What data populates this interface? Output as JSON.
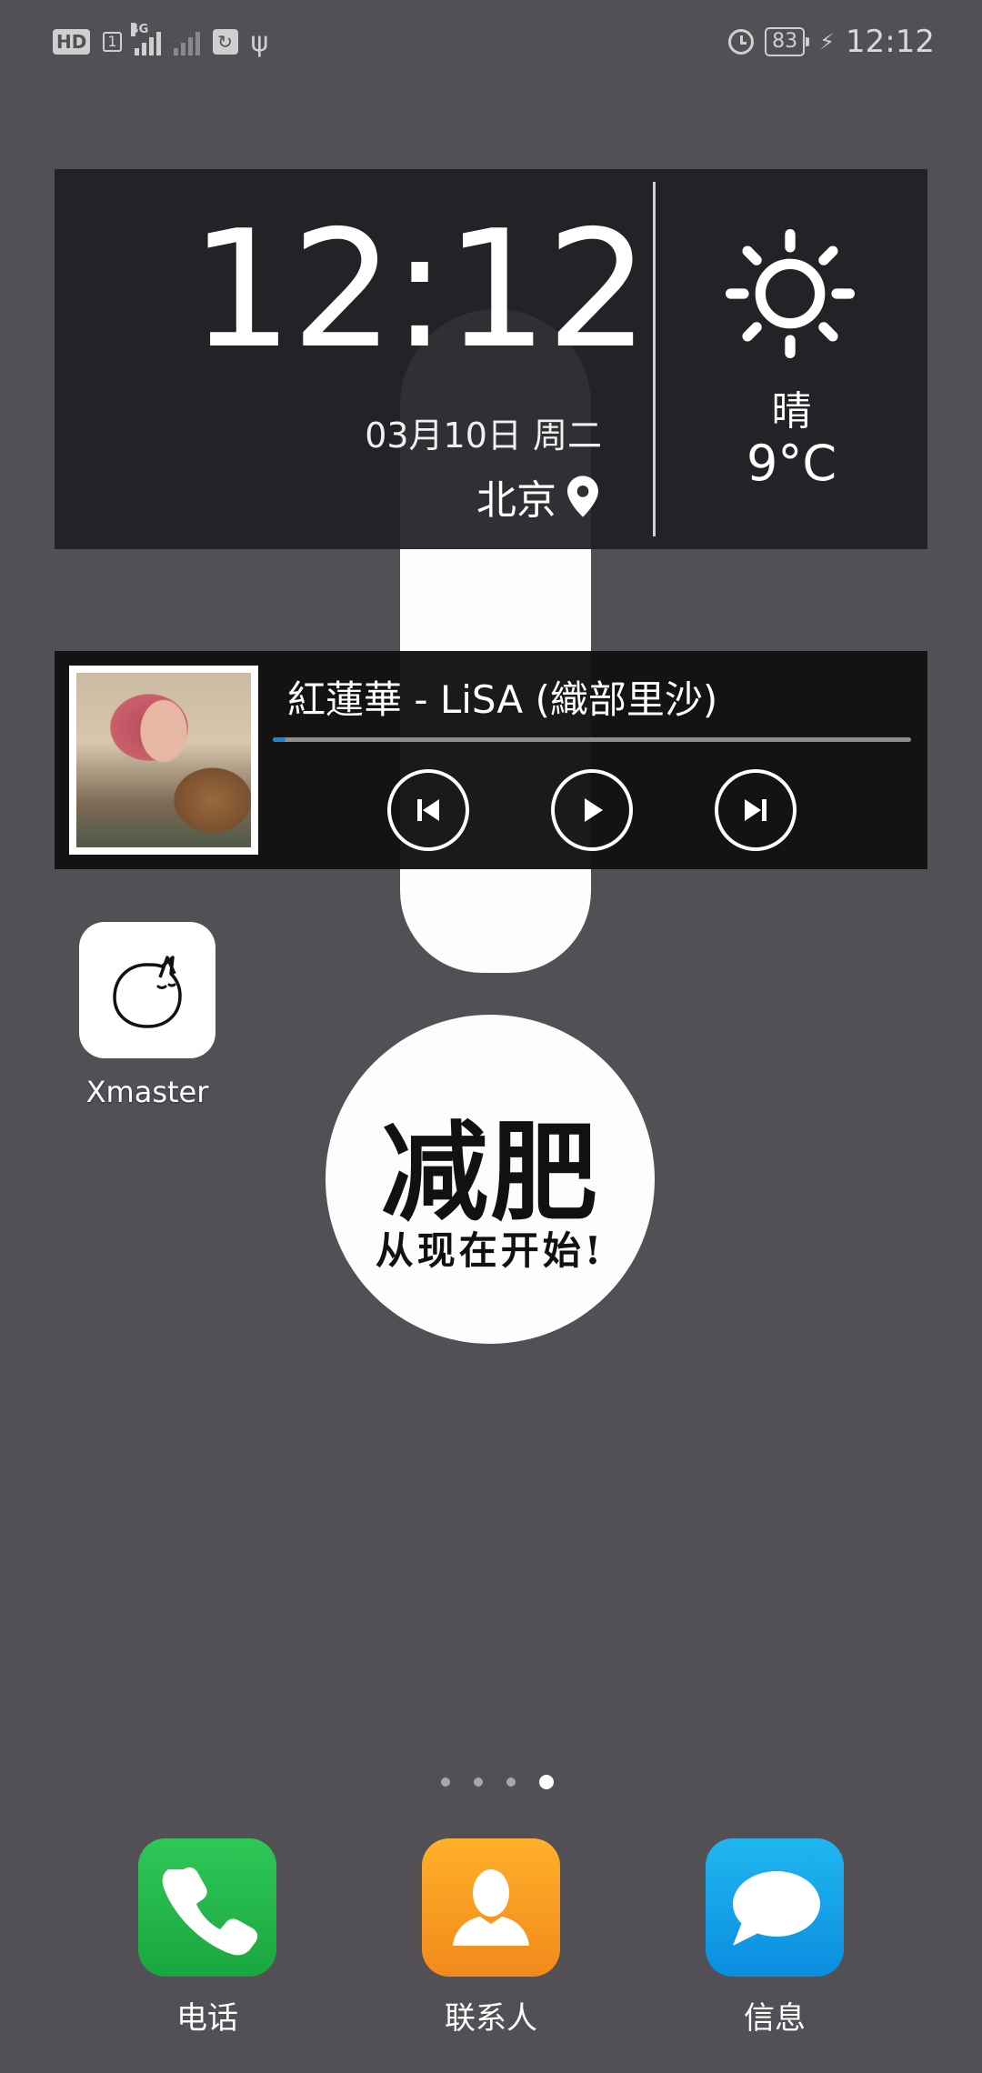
{
  "status_bar": {
    "hd_badge": "HD",
    "sim_slot": "1",
    "network": "4G",
    "battery": "83",
    "time": "12:12"
  },
  "wallpaper": {
    "headline": "减肥",
    "slogan": "从现在开始!"
  },
  "clock_widget": {
    "time": "12:12",
    "date": "03月10日 周二",
    "city": "北京",
    "weather_condition": "晴",
    "temperature": "9°C",
    "weather_icon": "sun-icon"
  },
  "music_widget": {
    "song_title": "紅蓮華 - LiSA (織部里沙)",
    "progress_fraction": 0.02,
    "progress_color": "#1a86d6"
  },
  "apps": [
    {
      "label": "Xmaster",
      "icon": "cat-icon"
    }
  ],
  "page_indicator": {
    "total": 4,
    "active_index": 3
  },
  "dock": [
    {
      "label": "电话",
      "icon": "phone-icon"
    },
    {
      "label": "联系人",
      "icon": "contacts-icon"
    },
    {
      "label": "信息",
      "icon": "message-icon"
    }
  ]
}
